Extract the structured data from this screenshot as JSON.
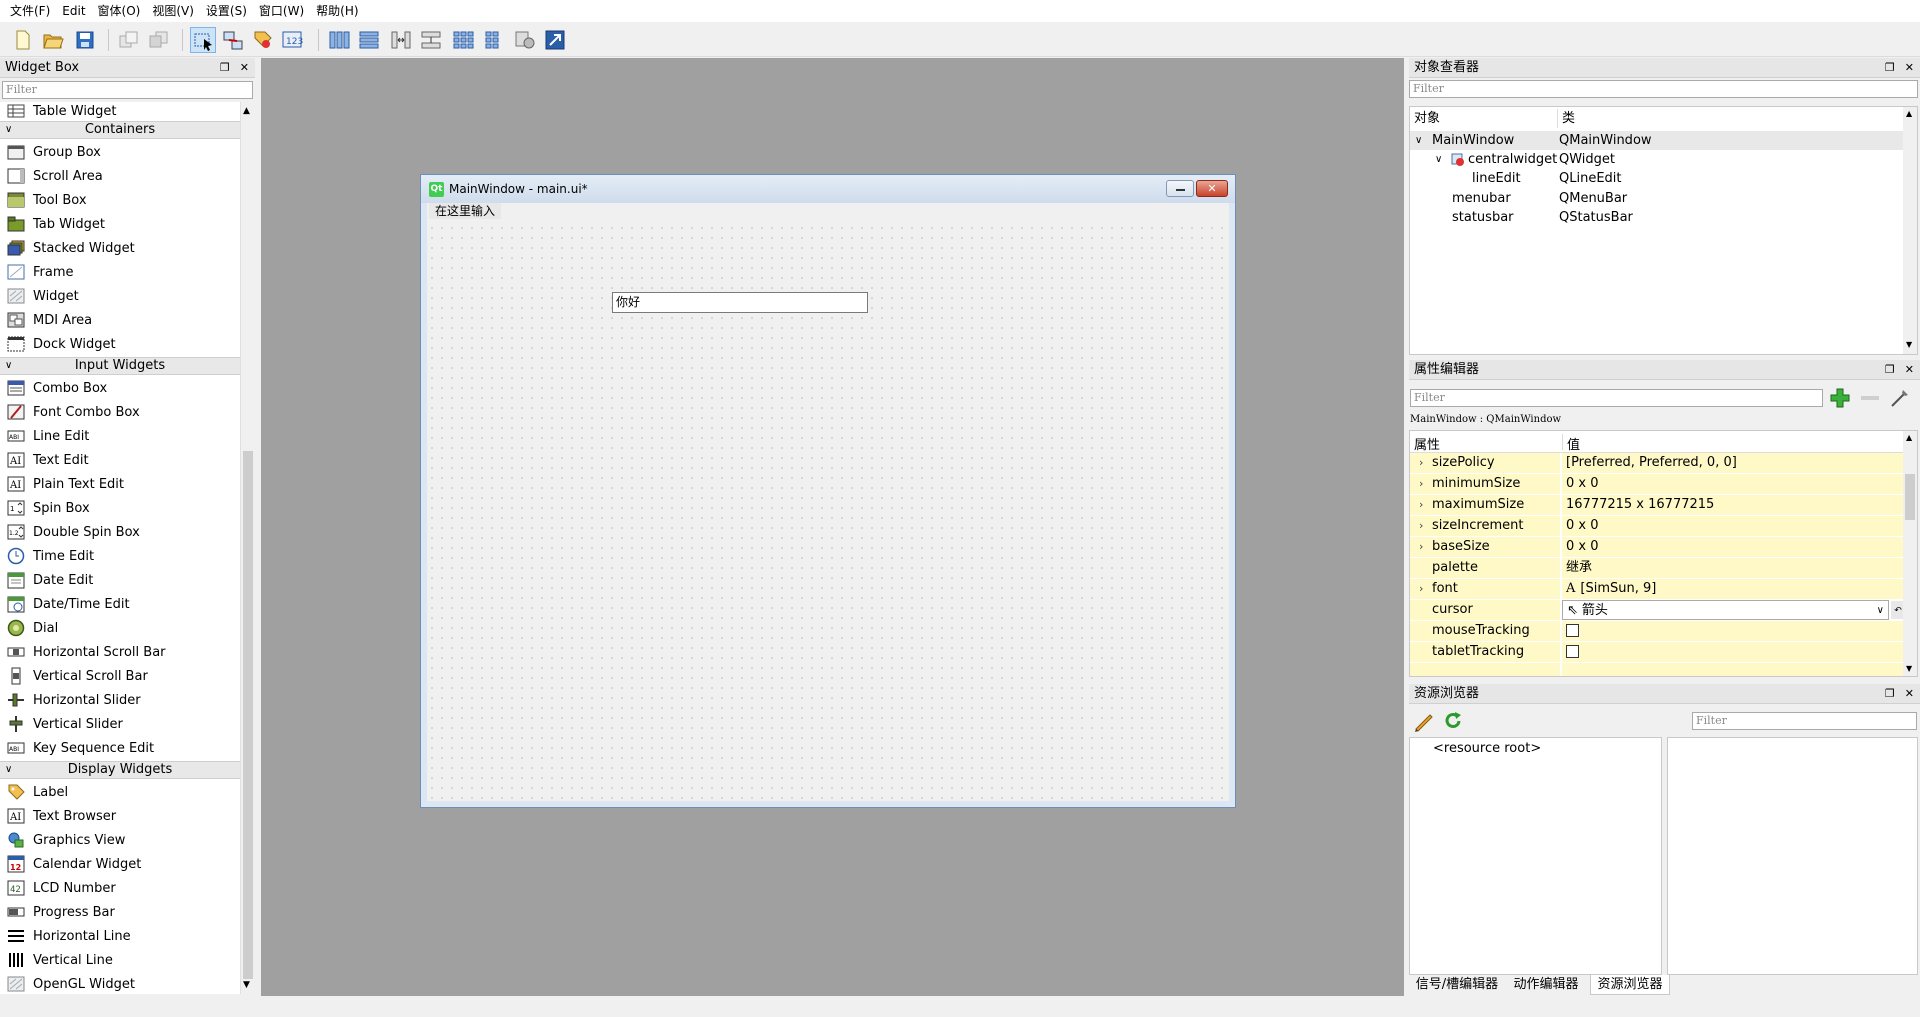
{
  "menu": [
    "文件(F)",
    "Edit",
    "窗体(O)",
    "视图(V)",
    "设置(S)",
    "窗口(W)",
    "帮助(H)"
  ],
  "widget_box": {
    "title": "Widget Box",
    "filter_placeholder": "Filter",
    "partial_item": "Table Widget",
    "categories": {
      "containers": "Containers",
      "input": "Input Widgets",
      "display": "Display Widgets"
    },
    "containers": [
      "Group Box",
      "Scroll Area",
      "Tool Box",
      "Tab Widget",
      "Stacked Widget",
      "Frame",
      "Widget",
      "MDI Area",
      "Dock Widget"
    ],
    "input": [
      "Combo Box",
      "Font Combo Box",
      "Line Edit",
      "Text Edit",
      "Plain Text Edit",
      "Spin Box",
      "Double Spin Box",
      "Time Edit",
      "Date Edit",
      "Date/Time Edit",
      "Dial",
      "Horizontal Scroll Bar",
      "Vertical Scroll Bar",
      "Horizontal Slider",
      "Vertical Slider",
      "Key Sequence Edit"
    ],
    "display": [
      "Label",
      "Text Browser",
      "Graphics View",
      "Calendar Widget",
      "LCD Number",
      "Progress Bar",
      "Horizontal Line",
      "Vertical Line",
      "OpenGL Widget"
    ]
  },
  "form": {
    "title": "MainWindow - main.ui*",
    "menu_placeholder": "在这里输入",
    "line_edit_value": "你好"
  },
  "object_inspector": {
    "title": "对象查看器",
    "filter_placeholder": "Filter",
    "col_object": "对象",
    "col_class": "类",
    "rows": [
      {
        "name": "MainWindow",
        "cls": "QMainWindow"
      },
      {
        "name": "centralwidget",
        "cls": "QWidget"
      },
      {
        "name": "lineEdit",
        "cls": "QLineEdit"
      },
      {
        "name": "menubar",
        "cls": "QMenuBar"
      },
      {
        "name": "statusbar",
        "cls": "QStatusBar"
      }
    ]
  },
  "property_editor": {
    "title": "属性编辑器",
    "filter_placeholder": "Filter",
    "context": "MainWindow : QMainWindow",
    "col_prop": "属性",
    "col_value": "值",
    "rows": [
      {
        "name": "sizePolicy",
        "value": "[Preferred, Preferred, 0, 0]"
      },
      {
        "name": "minimumSize",
        "value": "0 x 0"
      },
      {
        "name": "maximumSize",
        "value": "16777215 x 16777215"
      },
      {
        "name": "sizeIncrement",
        "value": "0 x 0"
      },
      {
        "name": "baseSize",
        "value": "0 x 0"
      },
      {
        "name": "palette",
        "value": "继承"
      },
      {
        "name": "font",
        "value": "[SimSun, 9]"
      },
      {
        "name": "cursor",
        "value": "箭头"
      },
      {
        "name": "mouseTracking",
        "value": ""
      },
      {
        "name": "tabletTracking",
        "value": ""
      }
    ]
  },
  "resource_browser": {
    "title": "资源浏览器",
    "filter_placeholder": "Filter",
    "root": "<resource root>"
  },
  "bottom_tabs": [
    "信号/槽编辑器",
    "动作编辑器",
    "资源浏览器"
  ]
}
